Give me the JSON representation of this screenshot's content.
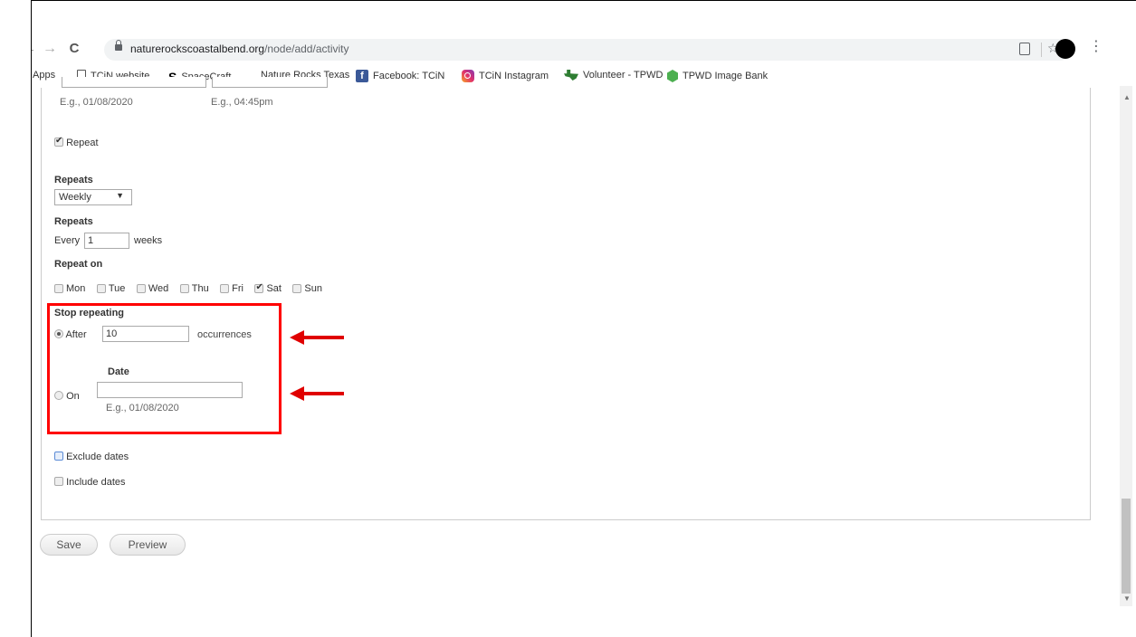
{
  "browser": {
    "url_domain": "naturerockscoastalbend.org",
    "url_path": "/node/add/activity",
    "back": "←",
    "forward": "→",
    "reload": "C",
    "star": "☆",
    "menu": "⋮"
  },
  "bookmarks": [
    {
      "label": "Apps"
    },
    {
      "label": "TCiN website"
    },
    {
      "label": "SpaceCraft"
    },
    {
      "label": "Nature Rocks Texas"
    },
    {
      "label": "Facebook: TCiN"
    },
    {
      "label": "TCiN Instagram"
    },
    {
      "label": "Volunteer - TPWD"
    },
    {
      "label": "TPWD Image Bank"
    }
  ],
  "form": {
    "date_hint": "E.g., 01/08/2020",
    "time_hint": "E.g., 04:45pm",
    "repeat_label": "Repeat",
    "repeats_label": "Repeats",
    "repeats_value": "Weekly",
    "repeats2_label": "Repeats",
    "every_label": "Every",
    "every_value": "1",
    "weeks_label": "weeks",
    "repeat_on_label": "Repeat on",
    "weekdays": [
      {
        "label": "Mon",
        "checked": false
      },
      {
        "label": "Tue",
        "checked": false
      },
      {
        "label": "Wed",
        "checked": false
      },
      {
        "label": "Thu",
        "checked": false
      },
      {
        "label": "Fri",
        "checked": false
      },
      {
        "label": "Sat",
        "checked": true
      },
      {
        "label": "Sun",
        "checked": false
      }
    ],
    "stop_repeating_label": "Stop repeating",
    "after_label": "After",
    "after_value": "10",
    "occurrences_label": "occurrences",
    "date_label": "Date",
    "on_label": "On",
    "on_date_hint": "E.g., 01/08/2020",
    "exclude_dates_label": "Exclude dates",
    "include_dates_label": "Include dates"
  },
  "buttons": {
    "save": "Save",
    "preview": "Preview"
  },
  "colors": {
    "highlight": "#ff0000",
    "arrow": "#e00000"
  }
}
